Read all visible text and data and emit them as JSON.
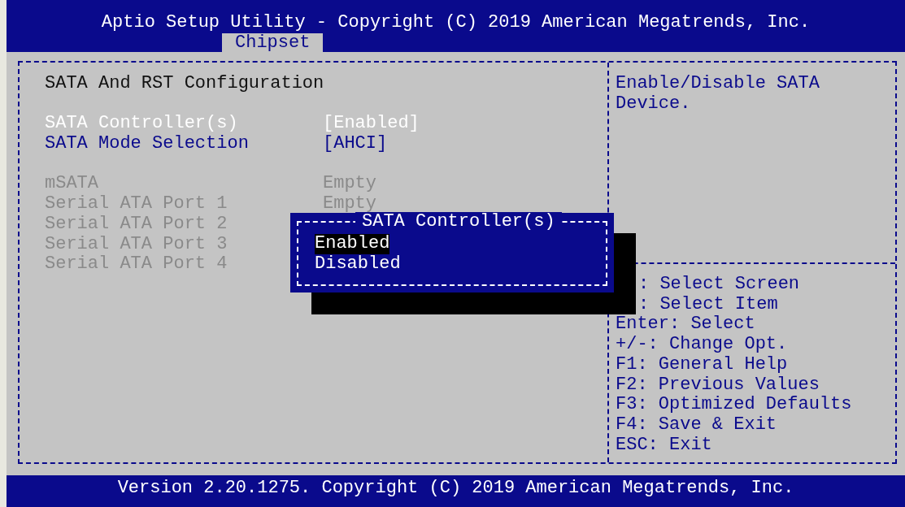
{
  "title": "Aptio Setup Utility - Copyright (C) 2019 American Megatrends, Inc.",
  "tabs": [
    {
      "label": "Chipset",
      "selected": true
    }
  ],
  "section_title": "SATA And RST Configuration",
  "setting_groups": [
    {
      "items": [
        {
          "label": "SATA Controller(s)",
          "value": "[Enabled]",
          "selected": true,
          "disabled": false
        },
        {
          "label": "SATA Mode Selection",
          "value": "[AHCI]",
          "selected": false,
          "disabled": false
        }
      ]
    },
    {
      "items": [
        {
          "label": "mSATA",
          "value": "Empty",
          "selected": false,
          "disabled": true
        },
        {
          "label": "Serial ATA Port 1",
          "value": "Empty",
          "selected": false,
          "disabled": true
        },
        {
          "label": "Serial ATA Port 2",
          "selected": false,
          "disabled": true
        },
        {
          "label": "Serial ATA Port 3",
          "selected": false,
          "disabled": true
        },
        {
          "label": "Serial ATA Port 4",
          "selected": false,
          "disabled": true
        }
      ]
    }
  ],
  "help_text": "Enable/Disable SATA Device.",
  "key_help": [
    ": Select Screen",
    ": Select Item",
    "Enter: Select",
    "+/-: Change Opt.",
    "F1: General Help",
    "F2: Previous Values",
    "F3: Optimized Defaults",
    "F4: Save & Exit",
    "ESC: Exit"
  ],
  "popup": {
    "title": "SATA Controller(s)",
    "options": [
      {
        "label": "Enabled",
        "selected": true
      },
      {
        "label": "Disabled",
        "selected": false
      }
    ]
  },
  "footer": "Version 2.20.1275. Copyright (C) 2019 American Megatrends, Inc."
}
